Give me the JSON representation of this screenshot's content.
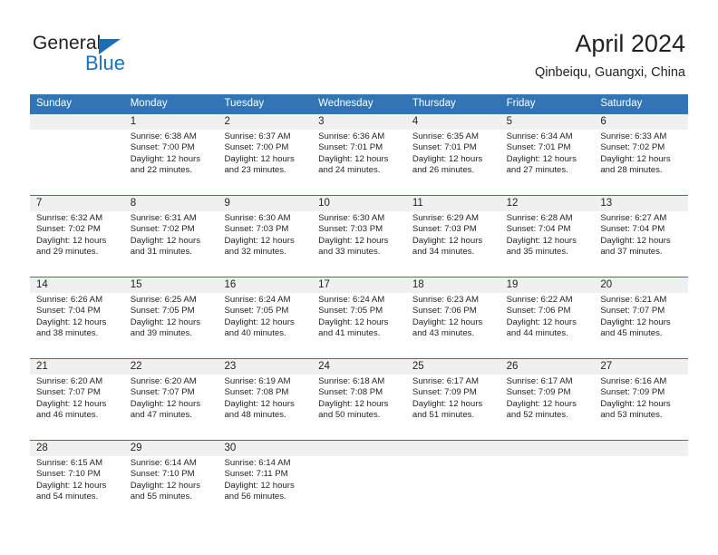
{
  "brand": {
    "word1": "General",
    "word2": "Blue",
    "triangle_color": "#1a6eb5",
    "blue_color": "#1a72bd"
  },
  "header": {
    "title": "April 2024",
    "subtitle": "Qinbeiqu, Guangxi, China"
  },
  "theme": {
    "header_blue": "#3175b4",
    "daynum_bg": "#f0f0f0",
    "text": "#231f20"
  },
  "calendar": {
    "weekday_headers": [
      "Sunday",
      "Monday",
      "Tuesday",
      "Wednesday",
      "Thursday",
      "Friday",
      "Saturday"
    ],
    "weeks": [
      {
        "daynums": [
          "",
          "1",
          "2",
          "3",
          "4",
          "5",
          "6"
        ],
        "cells": [
          {
            "empty": true,
            "l1": "",
            "l2": "",
            "l3": "",
            "l4": ""
          },
          {
            "empty": false,
            "l1": "Sunrise: 6:38 AM",
            "l2": "Sunset: 7:00 PM",
            "l3": "Daylight: 12 hours",
            "l4": "and 22 minutes."
          },
          {
            "empty": false,
            "l1": "Sunrise: 6:37 AM",
            "l2": "Sunset: 7:00 PM",
            "l3": "Daylight: 12 hours",
            "l4": "and 23 minutes."
          },
          {
            "empty": false,
            "l1": "Sunrise: 6:36 AM",
            "l2": "Sunset: 7:01 PM",
            "l3": "Daylight: 12 hours",
            "l4": "and 24 minutes."
          },
          {
            "empty": false,
            "l1": "Sunrise: 6:35 AM",
            "l2": "Sunset: 7:01 PM",
            "l3": "Daylight: 12 hours",
            "l4": "and 26 minutes."
          },
          {
            "empty": false,
            "l1": "Sunrise: 6:34 AM",
            "l2": "Sunset: 7:01 PM",
            "l3": "Daylight: 12 hours",
            "l4": "and 27 minutes."
          },
          {
            "empty": false,
            "l1": "Sunrise: 6:33 AM",
            "l2": "Sunset: 7:02 PM",
            "l3": "Daylight: 12 hours",
            "l4": "and 28 minutes."
          }
        ]
      },
      {
        "daynums": [
          "7",
          "8",
          "9",
          "10",
          "11",
          "12",
          "13"
        ],
        "cells": [
          {
            "empty": false,
            "l1": "Sunrise: 6:32 AM",
            "l2": "Sunset: 7:02 PM",
            "l3": "Daylight: 12 hours",
            "l4": "and 29 minutes."
          },
          {
            "empty": false,
            "l1": "Sunrise: 6:31 AM",
            "l2": "Sunset: 7:02 PM",
            "l3": "Daylight: 12 hours",
            "l4": "and 31 minutes."
          },
          {
            "empty": false,
            "l1": "Sunrise: 6:30 AM",
            "l2": "Sunset: 7:03 PM",
            "l3": "Daylight: 12 hours",
            "l4": "and 32 minutes."
          },
          {
            "empty": false,
            "l1": "Sunrise: 6:30 AM",
            "l2": "Sunset: 7:03 PM",
            "l3": "Daylight: 12 hours",
            "l4": "and 33 minutes."
          },
          {
            "empty": false,
            "l1": "Sunrise: 6:29 AM",
            "l2": "Sunset: 7:03 PM",
            "l3": "Daylight: 12 hours",
            "l4": "and 34 minutes."
          },
          {
            "empty": false,
            "l1": "Sunrise: 6:28 AM",
            "l2": "Sunset: 7:04 PM",
            "l3": "Daylight: 12 hours",
            "l4": "and 35 minutes."
          },
          {
            "empty": false,
            "l1": "Sunrise: 6:27 AM",
            "l2": "Sunset: 7:04 PM",
            "l3": "Daylight: 12 hours",
            "l4": "and 37 minutes."
          }
        ]
      },
      {
        "daynums": [
          "14",
          "15",
          "16",
          "17",
          "18",
          "19",
          "20"
        ],
        "cells": [
          {
            "empty": false,
            "l1": "Sunrise: 6:26 AM",
            "l2": "Sunset: 7:04 PM",
            "l3": "Daylight: 12 hours",
            "l4": "and 38 minutes."
          },
          {
            "empty": false,
            "l1": "Sunrise: 6:25 AM",
            "l2": "Sunset: 7:05 PM",
            "l3": "Daylight: 12 hours",
            "l4": "and 39 minutes."
          },
          {
            "empty": false,
            "l1": "Sunrise: 6:24 AM",
            "l2": "Sunset: 7:05 PM",
            "l3": "Daylight: 12 hours",
            "l4": "and 40 minutes."
          },
          {
            "empty": false,
            "l1": "Sunrise: 6:24 AM",
            "l2": "Sunset: 7:05 PM",
            "l3": "Daylight: 12 hours",
            "l4": "and 41 minutes."
          },
          {
            "empty": false,
            "l1": "Sunrise: 6:23 AM",
            "l2": "Sunset: 7:06 PM",
            "l3": "Daylight: 12 hours",
            "l4": "and 43 minutes."
          },
          {
            "empty": false,
            "l1": "Sunrise: 6:22 AM",
            "l2": "Sunset: 7:06 PM",
            "l3": "Daylight: 12 hours",
            "l4": "and 44 minutes."
          },
          {
            "empty": false,
            "l1": "Sunrise: 6:21 AM",
            "l2": "Sunset: 7:07 PM",
            "l3": "Daylight: 12 hours",
            "l4": "and 45 minutes."
          }
        ]
      },
      {
        "daynums": [
          "21",
          "22",
          "23",
          "24",
          "25",
          "26",
          "27"
        ],
        "cells": [
          {
            "empty": false,
            "l1": "Sunrise: 6:20 AM",
            "l2": "Sunset: 7:07 PM",
            "l3": "Daylight: 12 hours",
            "l4": "and 46 minutes."
          },
          {
            "empty": false,
            "l1": "Sunrise: 6:20 AM",
            "l2": "Sunset: 7:07 PM",
            "l3": "Daylight: 12 hours",
            "l4": "and 47 minutes."
          },
          {
            "empty": false,
            "l1": "Sunrise: 6:19 AM",
            "l2": "Sunset: 7:08 PM",
            "l3": "Daylight: 12 hours",
            "l4": "and 48 minutes."
          },
          {
            "empty": false,
            "l1": "Sunrise: 6:18 AM",
            "l2": "Sunset: 7:08 PM",
            "l3": "Daylight: 12 hours",
            "l4": "and 50 minutes."
          },
          {
            "empty": false,
            "l1": "Sunrise: 6:17 AM",
            "l2": "Sunset: 7:09 PM",
            "l3": "Daylight: 12 hours",
            "l4": "and 51 minutes."
          },
          {
            "empty": false,
            "l1": "Sunrise: 6:17 AM",
            "l2": "Sunset: 7:09 PM",
            "l3": "Daylight: 12 hours",
            "l4": "and 52 minutes."
          },
          {
            "empty": false,
            "l1": "Sunrise: 6:16 AM",
            "l2": "Sunset: 7:09 PM",
            "l3": "Daylight: 12 hours",
            "l4": "and 53 minutes."
          }
        ]
      },
      {
        "daynums": [
          "28",
          "29",
          "30",
          "",
          "",
          "",
          ""
        ],
        "cells": [
          {
            "empty": false,
            "l1": "Sunrise: 6:15 AM",
            "l2": "Sunset: 7:10 PM",
            "l3": "Daylight: 12 hours",
            "l4": "and 54 minutes."
          },
          {
            "empty": false,
            "l1": "Sunrise: 6:14 AM",
            "l2": "Sunset: 7:10 PM",
            "l3": "Daylight: 12 hours",
            "l4": "and 55 minutes."
          },
          {
            "empty": false,
            "l1": "Sunrise: 6:14 AM",
            "l2": "Sunset: 7:11 PM",
            "l3": "Daylight: 12 hours",
            "l4": "and 56 minutes."
          },
          {
            "empty": true,
            "l1": "",
            "l2": "",
            "l3": "",
            "l4": ""
          },
          {
            "empty": true,
            "l1": "",
            "l2": "",
            "l3": "",
            "l4": ""
          },
          {
            "empty": true,
            "l1": "",
            "l2": "",
            "l3": "",
            "l4": ""
          },
          {
            "empty": true,
            "l1": "",
            "l2": "",
            "l3": "",
            "l4": ""
          }
        ]
      }
    ]
  }
}
